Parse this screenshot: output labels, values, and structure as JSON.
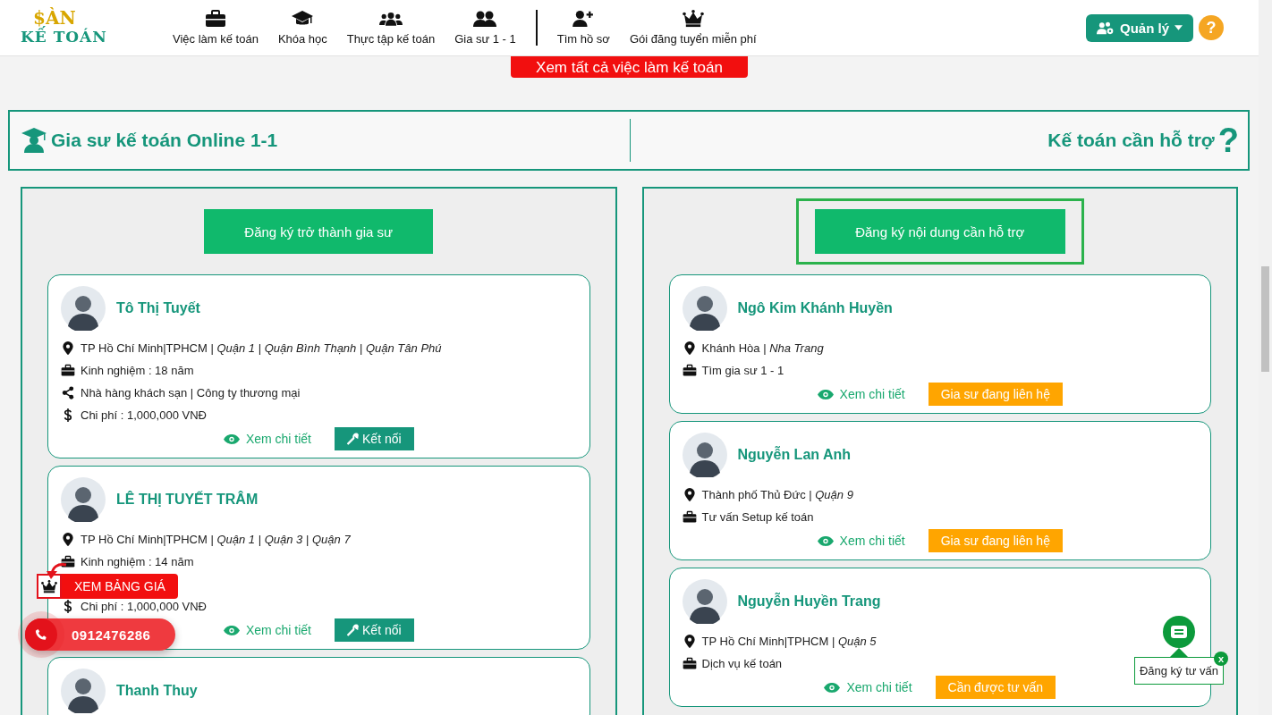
{
  "header": {
    "logo_top": "$ÀN",
    "logo_bottom": "KẾ TOÁN",
    "nav": [
      {
        "label": "Việc làm kế toán",
        "divider_before": false
      },
      {
        "label": "Khóa học",
        "divider_before": false
      },
      {
        "label": "Thực tập kế toán",
        "divider_before": false
      },
      {
        "label": "Gia sư 1 - 1",
        "divider_before": false
      },
      {
        "label": "Tìm hồ sơ",
        "divider_before": true
      },
      {
        "label": "Gói đăng tuyển miễn phí",
        "divider_before": false
      }
    ],
    "manage_button": "Quản lý",
    "help": "?"
  },
  "see_all_button": "Xem tất cả việc làm kế toán",
  "section_header": {
    "left_title": "Gia sư kế toán Online 1-1",
    "right_title": "Kế toán cần hỗ trợ",
    "right_mark": "?"
  },
  "columns": [
    {
      "register_button": "Đăng ký trở thành gia sư",
      "highlighted": false,
      "cards": [
        {
          "name": "Tô Thị Tuyết",
          "lines": [
            {
              "kind": "location",
              "text": "TP Hồ Chí Minh|TPHCM | *Quận 1*  | *Quận Bình Thạnh*  | *Quận Tân Phú*"
            },
            {
              "kind": "experience",
              "text": "Kinh nghiệm : 18 năm"
            },
            {
              "kind": "field",
              "text": "Nhà hàng khách sạn | Công ty thương mại"
            },
            {
              "kind": "cost",
              "text": "Chi phí : 1,000,000 VNĐ"
            }
          ],
          "detail_link": "Xem chi tiết",
          "action": {
            "kind": "connect",
            "label": "Kết nối"
          }
        },
        {
          "name": "LÊ THỊ TUYẾT TRÂM",
          "lines": [
            {
              "kind": "location",
              "text": "TP Hồ Chí Minh|TPHCM | *Quận 1*  | *Quận 3*  | *Quận 7*"
            },
            {
              "kind": "experience",
              "text": "Kinh nghiệm : 14 năm"
            },
            {
              "kind": "cost",
              "text": "Chi phí : 1,000,000 VNĐ"
            }
          ],
          "detail_link": "Xem chi tiết",
          "action": {
            "kind": "connect",
            "label": "Kết nối"
          }
        },
        {
          "name": "Thanh Thuy"
        }
      ]
    },
    {
      "register_button": "Đăng ký nội dung cần hỗ trợ",
      "highlighted": true,
      "cards": [
        {
          "name": "Ngô Kim Khánh Huyền",
          "lines": [
            {
              "kind": "location",
              "text": "Khánh Hòa | *Nha Trang*"
            },
            {
              "kind": "experience",
              "text": "Tìm gia sư 1 - 1"
            }
          ],
          "detail_link": "Xem chi tiết",
          "action": {
            "kind": "status",
            "label": "Gia sư đang liên hệ"
          }
        },
        {
          "name": "Nguyễn Lan Anh",
          "lines": [
            {
              "kind": "location",
              "text": "Thành phố Thủ Đức | *Quận 9*"
            },
            {
              "kind": "experience",
              "text": "Tư vấn Setup kế toán"
            }
          ],
          "detail_link": "Xem chi tiết",
          "action": {
            "kind": "status",
            "label": "Gia sư đang liên hệ"
          }
        },
        {
          "name": "Nguyễn Huyền Trang",
          "lines": [
            {
              "kind": "location",
              "text": "TP Hồ Chí Minh|TPHCM | *Quận 5*"
            },
            {
              "kind": "experience",
              "text": "Dịch vụ kế toán"
            }
          ],
          "detail_link": "Xem chi tiết",
          "action": {
            "kind": "status",
            "label": "Cần được tư vấn"
          }
        }
      ]
    }
  ],
  "price_badge": "XEM BẢNG GIÁ",
  "phone": "0912476286",
  "consult_widget": {
    "label": "Đăng ký tư vấn",
    "close": "x"
  }
}
